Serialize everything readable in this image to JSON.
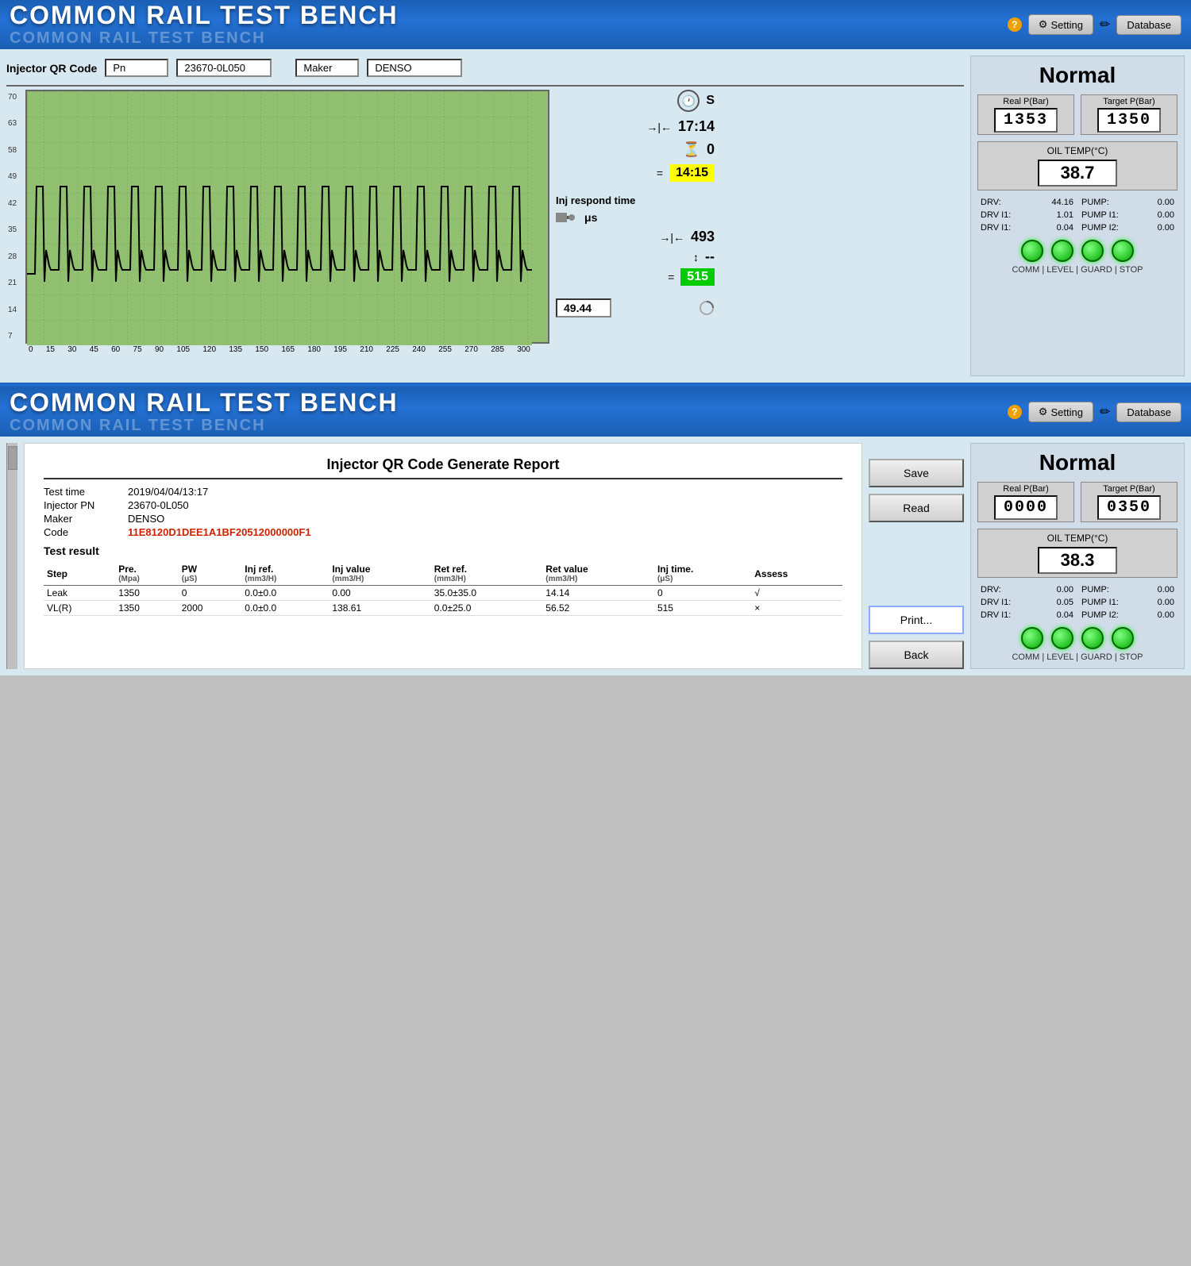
{
  "app": {
    "title": "COMMON RAIL TEST BENCH",
    "subtitle": "COMMON RAIL TEST BENCH",
    "setting_btn": "Setting",
    "database_btn": "Database"
  },
  "top_section": {
    "qr_label": "Injector QR Code",
    "pn_label": "Pn",
    "pn_value": "23670-0L050",
    "maker_label": "Maker",
    "maker_value": "DENSO",
    "chart": {
      "y_labels": [
        "70",
        "63",
        "58",
        "49",
        "42",
        "35",
        "28",
        "21",
        "14",
        "7"
      ],
      "x_labels": [
        "0",
        "15",
        "30",
        "45",
        "60",
        "75",
        "90",
        "105",
        "120",
        "135",
        "150",
        "165",
        "180",
        "195",
        "210",
        "225",
        "240",
        "255",
        "270",
        "285",
        "300"
      ]
    },
    "timing": {
      "s_label": "S",
      "time1": "17:14",
      "time2": "0",
      "time3_yellow": "14:15"
    },
    "inj_respond": {
      "label": "Inj respond time",
      "unit": "μs",
      "value1": "493",
      "dash": "--",
      "value2_green": "515"
    },
    "bottom_val": "49.44",
    "status": "Normal",
    "real_p_label": "Real P(Bar)",
    "target_p_label": "Target P(Bar)",
    "real_p_value": "1353",
    "target_p_value": "1350",
    "oil_temp_label": "OIL TEMP(°C)",
    "oil_temp_value": "38.7",
    "drv": [
      {
        "key": "DRV:",
        "val": "44.16"
      },
      {
        "key": "PUMP:",
        "val": "0.00"
      },
      {
        "key": "DRV I1:",
        "val": "1.01"
      },
      {
        "key": "PUMP I1:",
        "val": "0.00"
      },
      {
        "key": "DRV I1:",
        "val": "0.04"
      },
      {
        "key": "PUMP I2:",
        "val": "0.00"
      }
    ],
    "leds": [
      "COMM",
      "LEVEL",
      "GUARD",
      "STOP"
    ]
  },
  "bottom_section": {
    "report_title": "Injector QR Code Generate Report",
    "test_time_label": "Test time",
    "test_time_value": "2019/04/04/13:17",
    "injector_pn_label": "Injector PN",
    "injector_pn_value": "23670-0L050",
    "maker_label": "Maker",
    "maker_value": "DENSO",
    "code_label": "Code",
    "code_value": "11E8120D1DEE1A1BF20512000000F1",
    "test_result_label": "Test result",
    "table": {
      "headers": [
        "Step",
        "Pre.(Mpa)",
        "PW(μS)",
        "Inj ref.(mm3/H)",
        "Inj value(mm3/H)",
        "Ret ref.(mm3/H)",
        "Ret value(mm3/H)",
        "Inj time(μS)",
        "Assess"
      ],
      "rows": [
        [
          "Leak",
          "1350",
          "0",
          "0.0±0.0",
          "0.00",
          "35.0±35.0",
          "14.14",
          "0",
          "√"
        ],
        [
          "VL(R)",
          "1350",
          "2000",
          "0.0±0.0",
          "138.61",
          "0.0±25.0",
          "56.52",
          "515",
          "×"
        ]
      ]
    },
    "save_btn": "Save",
    "read_btn": "Read",
    "print_btn": "Print...",
    "back_btn": "Back",
    "status": "Normal",
    "real_p_label": "Real P(Bar)",
    "target_p_label": "Target P(Bar)",
    "real_p_value": "0000",
    "target_p_value": "0350",
    "oil_temp_label": "OIL TEMP(°C)",
    "oil_temp_value": "38.3",
    "drv2": [
      {
        "key": "DRV:",
        "val": "0.00"
      },
      {
        "key": "PUMP:",
        "val": "0.00"
      },
      {
        "key": "DRV I1:",
        "val": "0.05"
      },
      {
        "key": "PUMP I1:",
        "val": "0.00"
      },
      {
        "key": "DRV I1:",
        "val": "0.04"
      },
      {
        "key": "PUMP I2:",
        "val": "0.00"
      }
    ],
    "leds": [
      "COMM",
      "LEVEL",
      "GUARD",
      "STOP"
    ]
  }
}
